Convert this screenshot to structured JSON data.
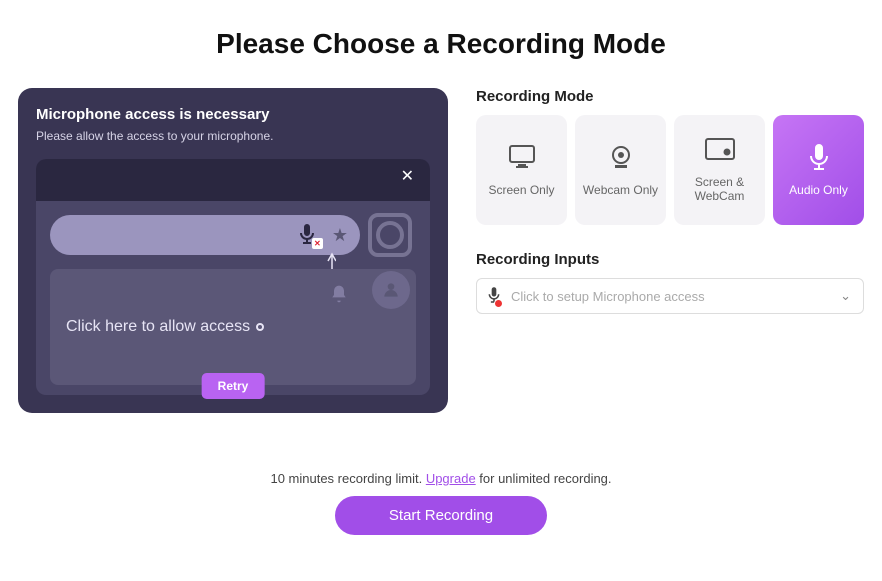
{
  "title": "Please Choose a Recording Mode",
  "panel": {
    "heading": "Microphone access is necessary",
    "subtext": "Please allow the access to your microphone.",
    "allow_text": "Click here to allow access",
    "retry_label": "Retry"
  },
  "sections": {
    "mode_label": "Recording Mode",
    "inputs_label": "Recording Inputs"
  },
  "modes": [
    {
      "id": "screen-only",
      "label": "Screen Only",
      "icon": "monitor-icon",
      "active": false
    },
    {
      "id": "webcam-only",
      "label": "Webcam Only",
      "icon": "webcam-icon",
      "active": false
    },
    {
      "id": "screen-webcam",
      "label": "Screen & WebCam",
      "icon": "pip-icon",
      "active": false
    },
    {
      "id": "audio-only",
      "label": "Audio Only",
      "icon": "mic-icon",
      "active": true
    }
  ],
  "inputs_dropdown": {
    "placeholder": "Click to setup Microphone access",
    "icon": "mic-blocked-icon"
  },
  "footer": {
    "limit_prefix": "10 minutes recording limit. ",
    "upgrade_label": "Upgrade",
    "limit_suffix": " for unlimited recording.",
    "start_label": "Start Recording"
  },
  "colors": {
    "accent": "#a14ee8",
    "panel_bg": "#393553"
  }
}
